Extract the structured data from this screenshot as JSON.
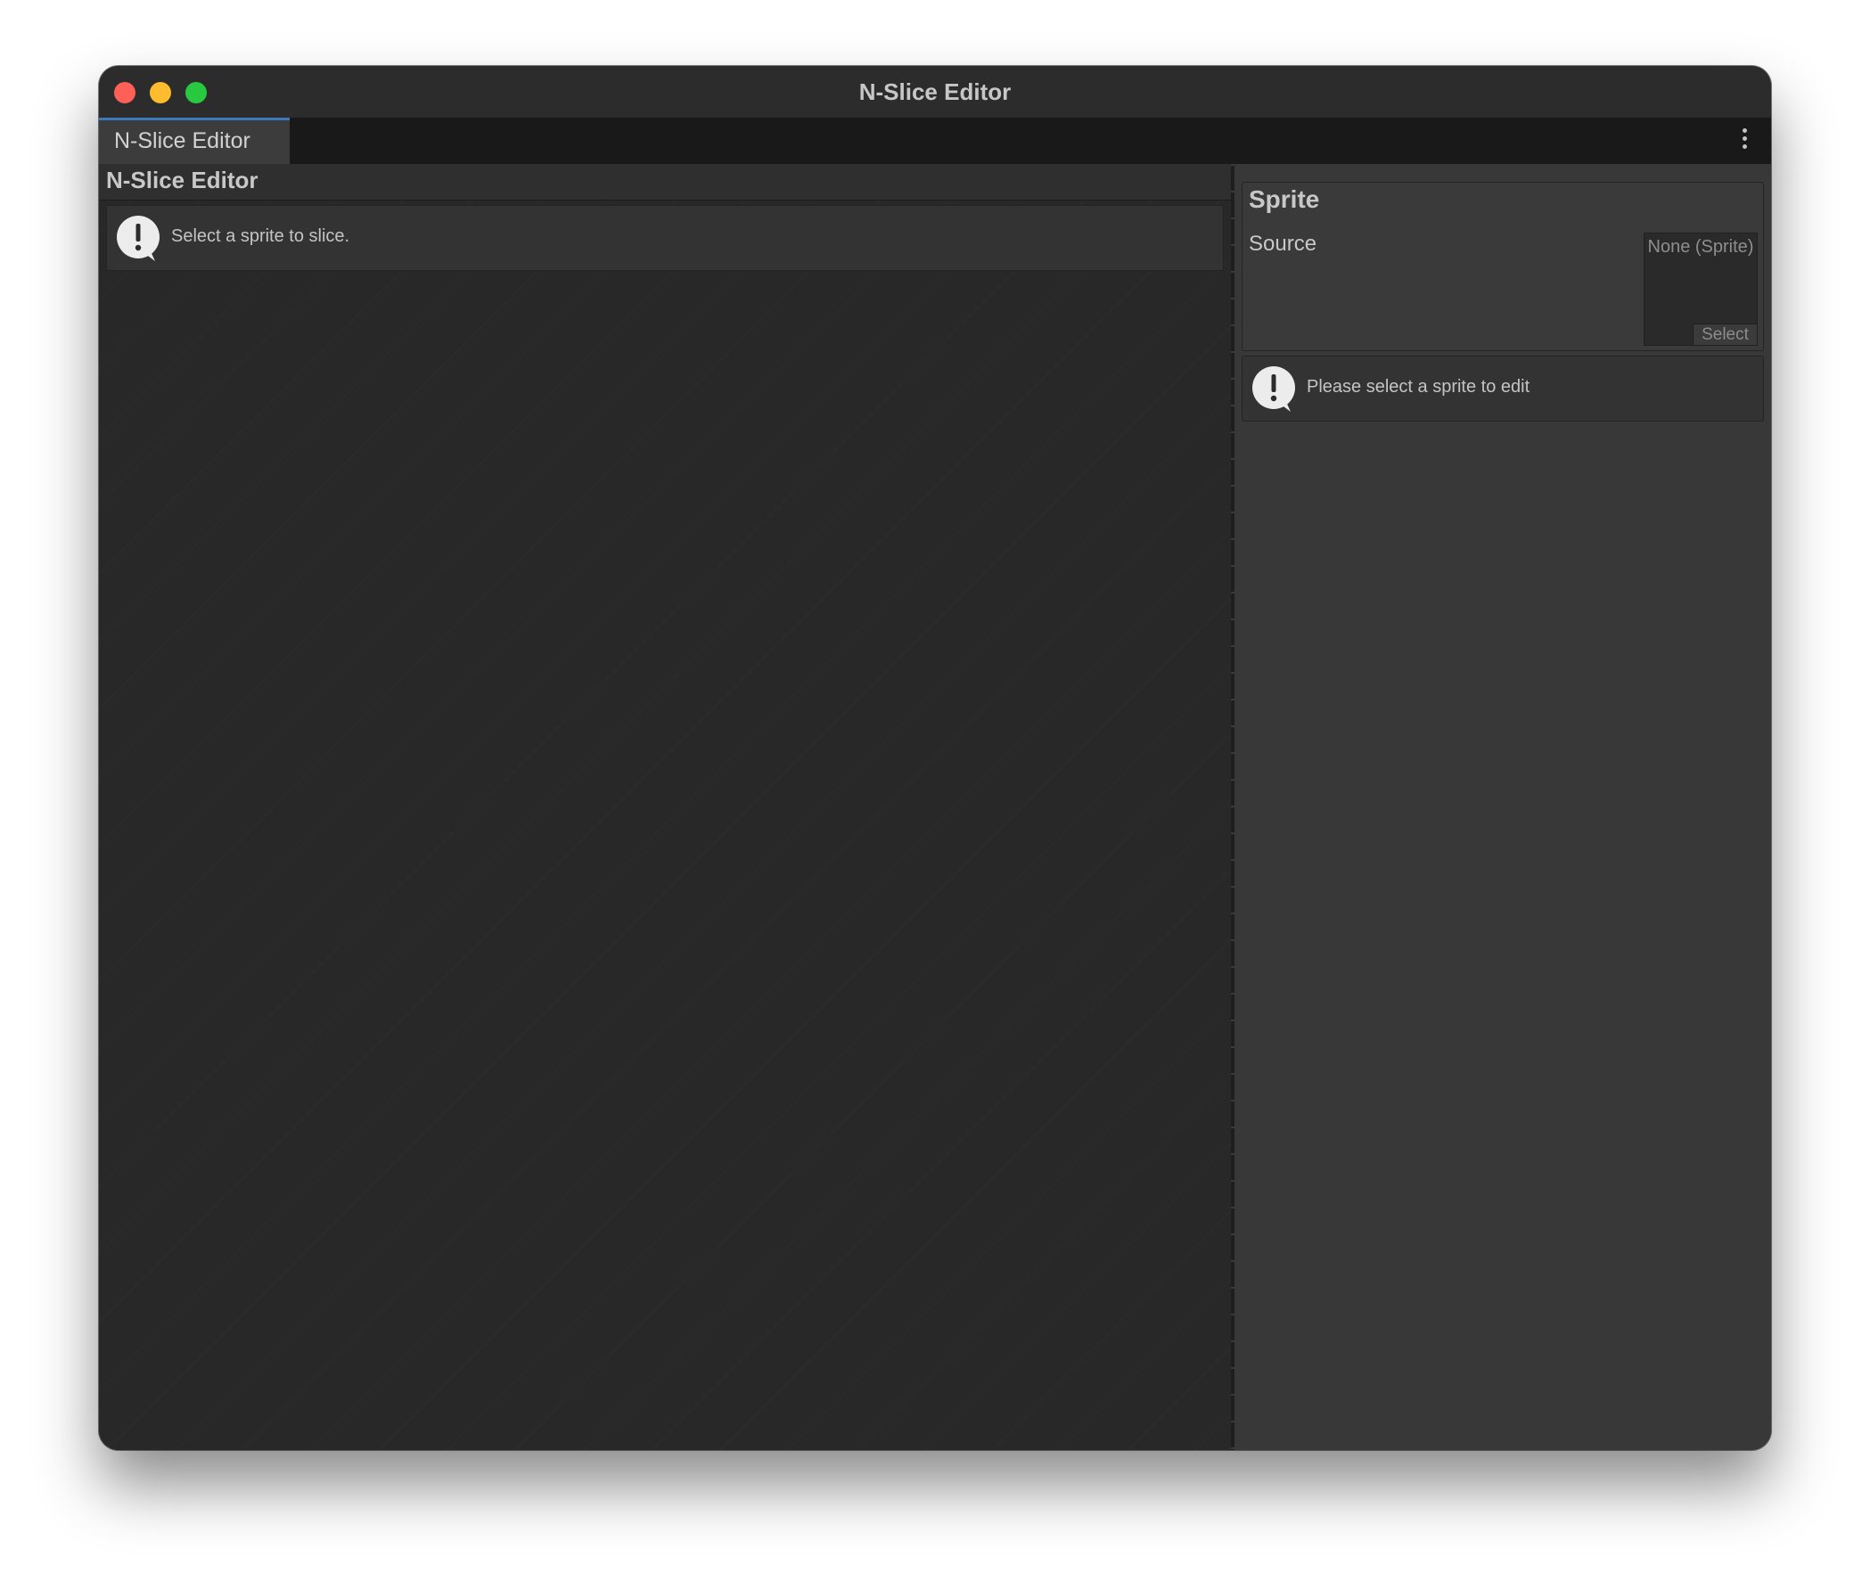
{
  "window": {
    "title": "N-Slice Editor"
  },
  "tabs": [
    {
      "label": "N-Slice Editor",
      "active": true
    }
  ],
  "left_panel": {
    "title": "N-Slice Editor",
    "help": {
      "icon": "alert-speech-icon",
      "message": "Select a sprite to slice."
    }
  },
  "right_panel": {
    "section_title": "Sprite",
    "source": {
      "label": "Source",
      "value": "None (Sprite)",
      "select_label": "Select"
    },
    "help": {
      "icon": "alert-speech-icon",
      "message": "Please select a sprite to edit"
    }
  },
  "colors": {
    "close": "#fe5f57",
    "minimize": "#febc2e",
    "maximize": "#28c840",
    "tab_accent": "#3a79bb"
  }
}
